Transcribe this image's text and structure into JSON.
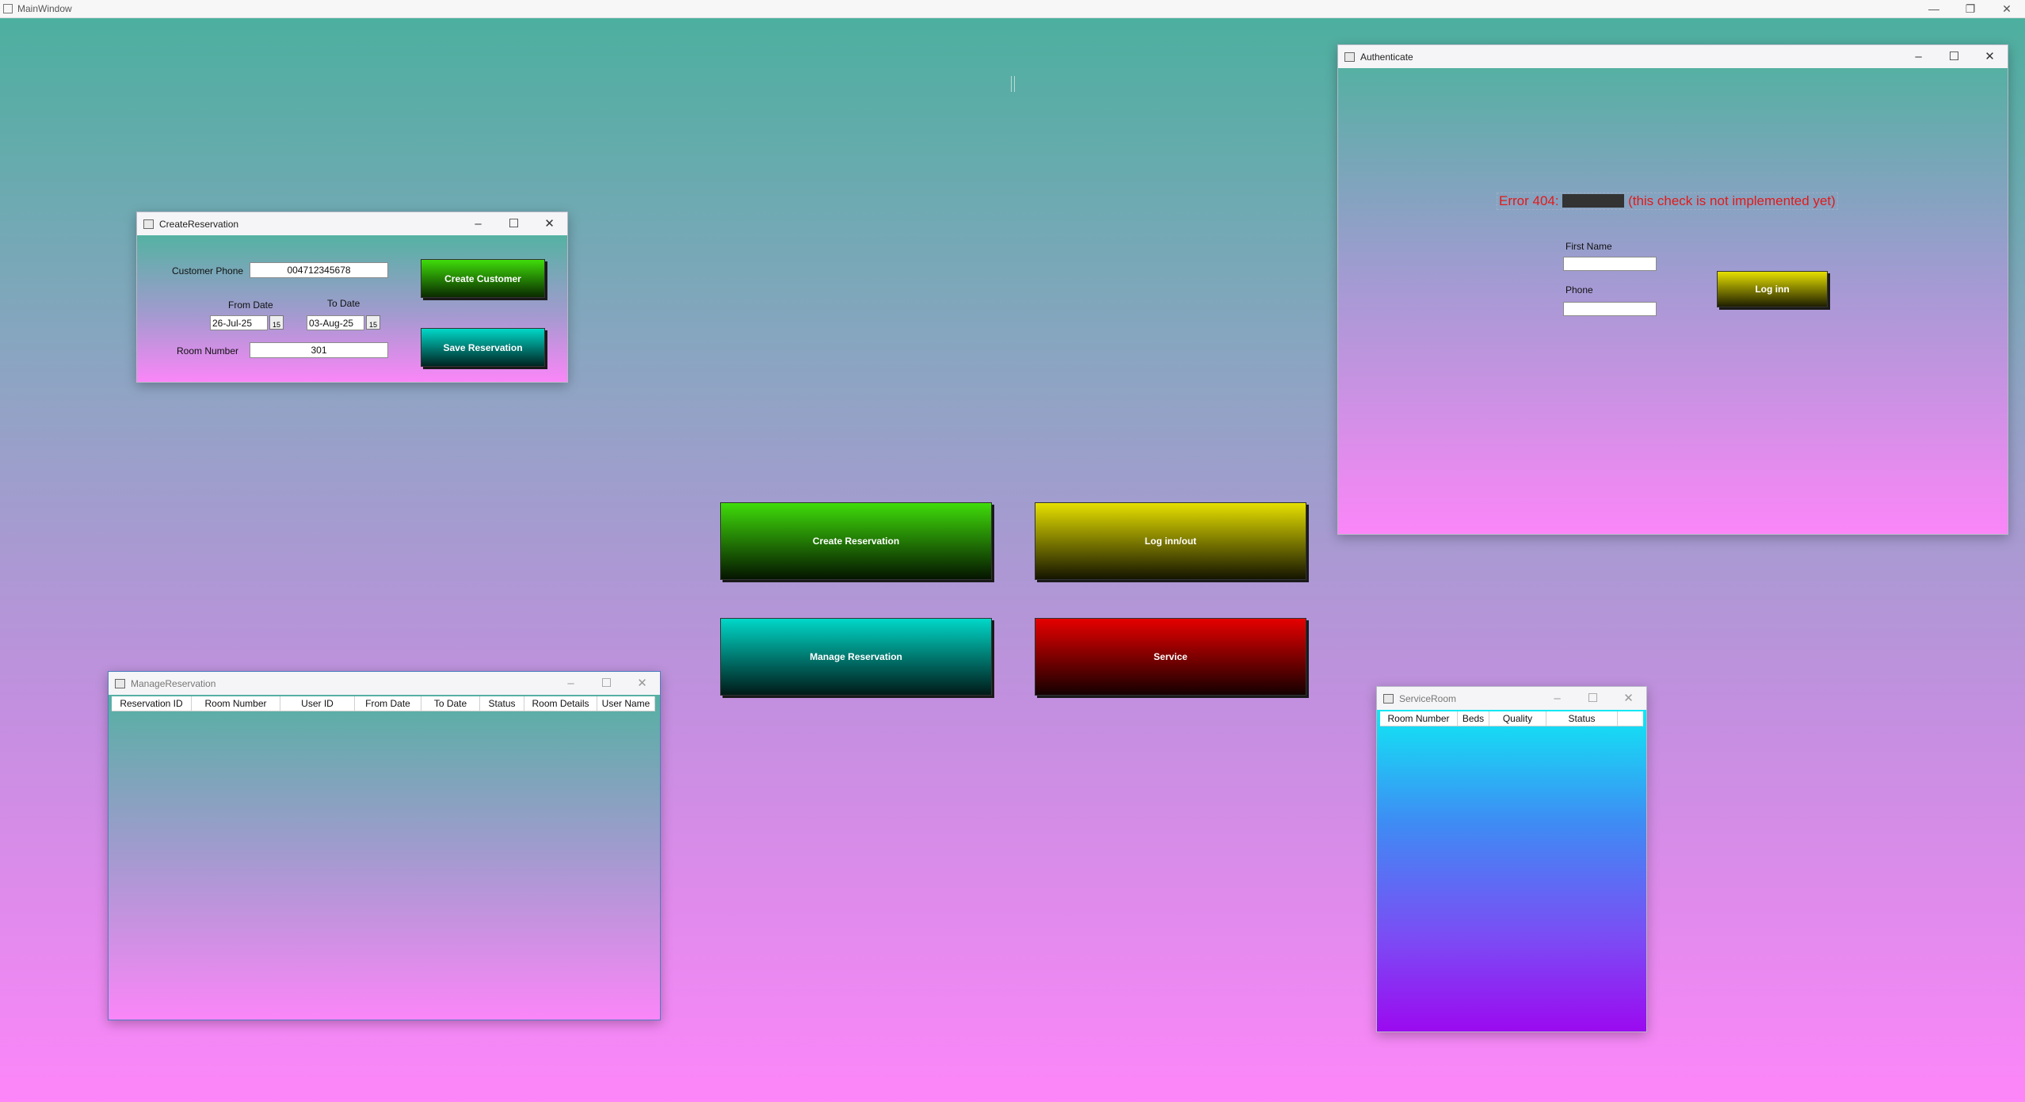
{
  "main": {
    "title": "MainWindow",
    "caption": {
      "minimize": "—",
      "restore": "❐",
      "close": "✕"
    }
  },
  "create_reservation": {
    "title": "CreateReservation",
    "customer_phone_label": "Customer Phone",
    "customer_phone_value": "004712345678",
    "from_date_label": "From Date",
    "from_date_value": "26-Jul-25",
    "to_date_label": "To Date",
    "to_date_value": "03-Aug-25",
    "calendar_glyph": "15",
    "room_number_label": "Room Number",
    "room_number_value": "301",
    "create_customer_label": "Create Customer",
    "save_reservation_label": "Save Reservation"
  },
  "authenticate": {
    "title": "Authenticate",
    "error_prefix": "Error 404:",
    "error_suffix": "(this check is not implemented yet)",
    "first_name_label": "First Name",
    "first_name_value": "",
    "phone_label": "Phone",
    "phone_value": "",
    "login_label": "Log inn"
  },
  "main_buttons": {
    "create_reservation": "Create Reservation",
    "log_in_out": "Log inn/out",
    "manage_reservation": "Manage Reservation",
    "service": "Service"
  },
  "manage_reservation": {
    "title": "ManageReservation",
    "columns": [
      "Reservation ID",
      "Room Number",
      "User ID",
      "From Date",
      "To Date",
      "Status",
      "Room Details",
      "User Name"
    ]
  },
  "service_room": {
    "title": "ServiceRoom",
    "columns": [
      "Room Number",
      "Beds",
      "Quality",
      "Status"
    ]
  },
  "colors": {
    "green_button": "#3fdc0a",
    "yellow_button": "#e6e000",
    "teal_button": "#00d8c8",
    "red_button": "#e60000",
    "error_text": "#e11a1a"
  }
}
